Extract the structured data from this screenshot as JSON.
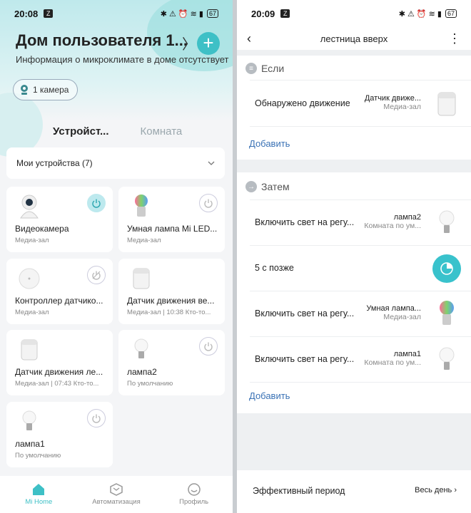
{
  "left": {
    "status": {
      "time": "20:08",
      "z": "Z",
      "icons": "✱ ⚠ ⏰ ≋ ▮",
      "battery": "67"
    },
    "home_title": "Дом пользователя 1...",
    "climate_info": "Информация о микроклимате в доме отсутствует",
    "camera_chip": "1 камера",
    "tabs": {
      "devices": "Устройст...",
      "room": "Комната"
    },
    "my_devices": "Мои устройства (7)",
    "devices": [
      {
        "name": "Видеокамера",
        "sub": "Медиа-зал",
        "icon": "camera-icon",
        "power": "on"
      },
      {
        "name": "Умная лампа Mi LED...",
        "sub": "Медиа-зал",
        "icon": "color-bulb-icon",
        "power": "off"
      },
      {
        "name": "Контроллер датчико...",
        "sub": "Медиа-зал",
        "icon": "hub-icon",
        "power": "disabled"
      },
      {
        "name": "Датчик движения ве...",
        "sub": "Медиа-зал | 10:38 Кто-то...",
        "icon": "motion-sensor-icon",
        "power": "none"
      },
      {
        "name": "Датчик движения ле...",
        "sub": "Медиа-зал | 07:43 Кто-то...",
        "icon": "motion-sensor-icon",
        "power": "none"
      },
      {
        "name": "лампа2",
        "sub": "По умолчанию",
        "icon": "bulb-icon",
        "power": "off"
      },
      {
        "name": "лампа1",
        "sub": "По умолчанию",
        "icon": "bulb-icon",
        "power": "off"
      }
    ],
    "nav": {
      "home": "Mi Home",
      "automation": "Автоматизация",
      "profile": "Профиль"
    },
    "accent": "#3ec0c6"
  },
  "right": {
    "status": {
      "time": "20:09",
      "z": "Z",
      "icons": "✱ ⚠ ⏰ ≋ ▮",
      "battery": "67"
    },
    "title": "лестница вверх",
    "if_section": {
      "header": "Если",
      "row": {
        "label": "Обнаружено движение",
        "device": "Датчик движе...",
        "room": "Медиа-зал"
      },
      "add": "Добавить"
    },
    "then_section": {
      "header": "Затем",
      "rows": [
        {
          "label": "Включить свет на регу...",
          "device": "лампа2",
          "room": "Комната по ум..."
        },
        {
          "label": "5 с позже"
        },
        {
          "label": "Включить свет на регу...",
          "device": "Умная лампа...",
          "room": "Медиа-зал"
        },
        {
          "label": "Включить свет на регу...",
          "device": "лампа1",
          "room": "Комната по ум..."
        }
      ],
      "add": "Добавить"
    },
    "effective": {
      "label": "Эффективный период",
      "value": "Весь день"
    },
    "link_color": "#3a72b5"
  }
}
